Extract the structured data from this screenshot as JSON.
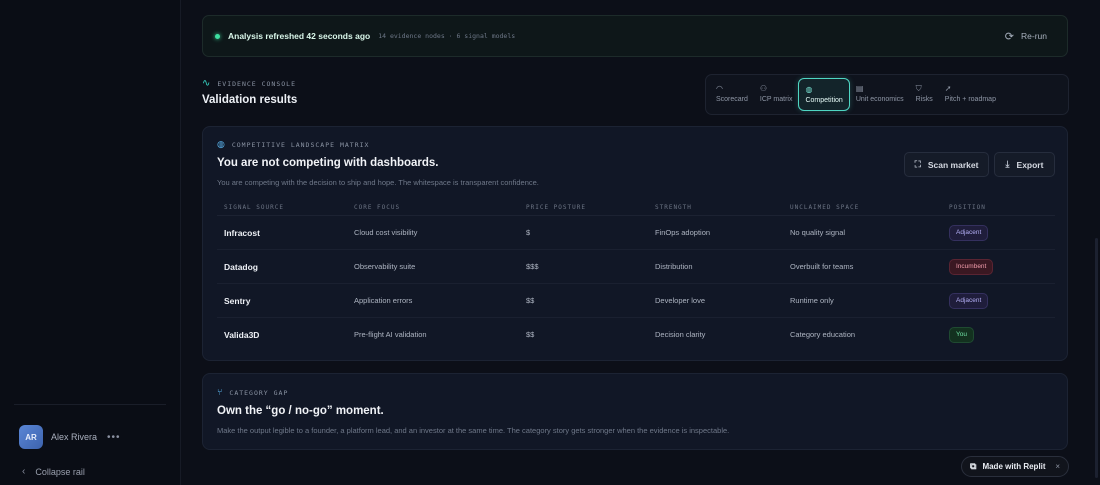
{
  "rail": {
    "user": {
      "initials": "AR",
      "name": "Alex Rivera",
      "more": "•••"
    },
    "collapse_label": "Collapse rail"
  },
  "status": {
    "text": "Analysis refreshed 42 seconds ago",
    "meta": "14 evidence nodes · 6 signal models",
    "rerun_label": "Re-run"
  },
  "header": {
    "section_label": "EVIDENCE CONSOLE",
    "title": "Validation results"
  },
  "tabs": [
    {
      "label": "Scorecard",
      "icon": "gauge-icon",
      "active": false
    },
    {
      "label": "ICP matrix",
      "icon": "users-icon",
      "active": false
    },
    {
      "label": "Competition",
      "icon": "globe-icon",
      "active": true
    },
    {
      "label": "Unit economics",
      "icon": "wallet-icon",
      "active": false
    },
    {
      "label": "Risks",
      "icon": "shield-icon",
      "active": false
    },
    {
      "label": "Pitch + roadmap",
      "icon": "rocket-icon",
      "active": false
    }
  ],
  "matrix": {
    "label": "COMPETITIVE LANDSCAPE MATRIX",
    "heading": "You are not competing with dashboards.",
    "sub": "You are competing with the decision to ship and hope. The whitespace is transparent confidence.",
    "scan_label": "Scan market",
    "export_label": "Export",
    "columns": [
      "SIGNAL SOURCE",
      "CORE FOCUS",
      "PRICE POSTURE",
      "STRENGTH",
      "UNCLAIMED SPACE",
      "POSITION"
    ],
    "rows": [
      {
        "source": "Infracost",
        "focus": "Cloud cost visibility",
        "price": "$",
        "strength": "FinOps adoption",
        "unclaimed": "No quality signal",
        "position": "Adjacent",
        "position_kind": "adjacent"
      },
      {
        "source": "Datadog",
        "focus": "Observability suite",
        "price": "$$$",
        "strength": "Distribution",
        "unclaimed": "Overbuilt for teams",
        "position": "Incumbent",
        "position_kind": "incumbent"
      },
      {
        "source": "Sentry",
        "focus": "Application errors",
        "price": "$$",
        "strength": "Developer love",
        "unclaimed": "Runtime only",
        "position": "Adjacent",
        "position_kind": "adjacent"
      },
      {
        "source": "Valida3D",
        "focus": "Pre-flight AI validation",
        "price": "$$",
        "strength": "Decision clarity",
        "unclaimed": "Category education",
        "position": "You",
        "position_kind": "you"
      }
    ]
  },
  "gap": {
    "label": "CATEGORY GAP",
    "heading": "Own the “go / no-go” moment.",
    "sub": "Make the output legible to a founder, a platform lead, and an investor at the same time. The category story gets stronger when the evidence is inspectable."
  },
  "badge": {
    "label": "Made with Replit",
    "close": "×"
  }
}
